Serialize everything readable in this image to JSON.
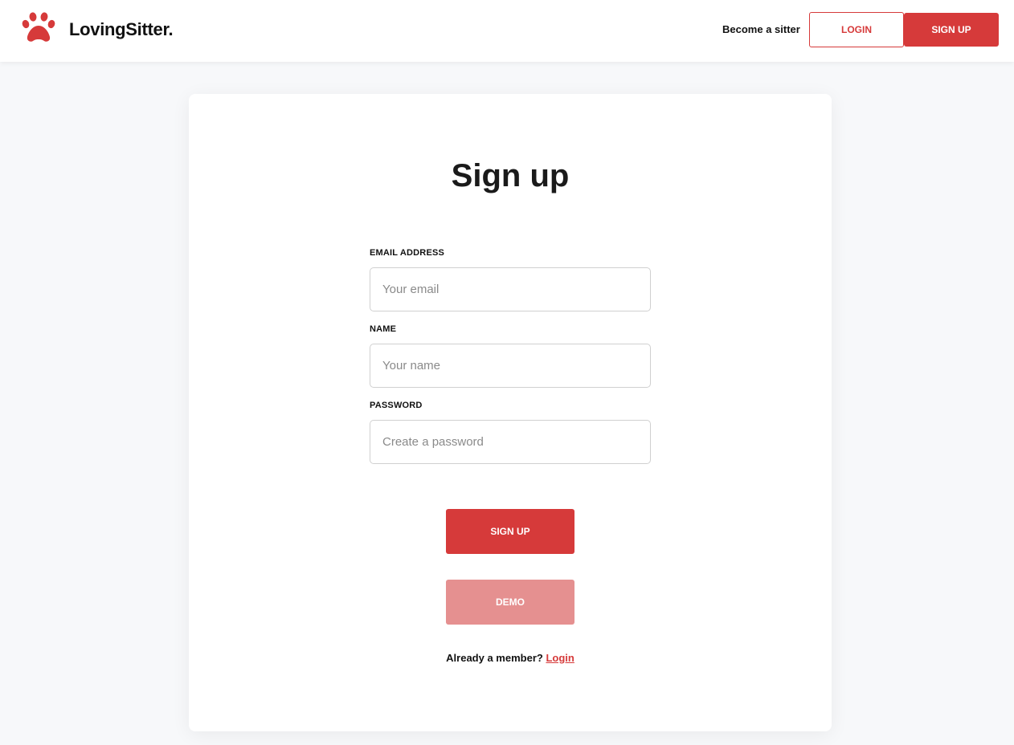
{
  "brand": {
    "name": "LovingSitter.",
    "accent_color": "#d63a3a",
    "logo_icon": "paw-icon"
  },
  "nav": {
    "become_sitter": "Become a sitter",
    "login": "LOGIN",
    "signup": "SIGN UP"
  },
  "form": {
    "title": "Sign up",
    "email_label": "EMAIL ADDRESS",
    "email_placeholder": "Your email",
    "name_label": "NAME",
    "name_placeholder": "Your name",
    "password_label": "PASSWORD",
    "password_placeholder": "Create a password",
    "submit": "SIGN UP",
    "demo": "DEMO",
    "member_text": "Already a member?",
    "login_link": "Login"
  }
}
